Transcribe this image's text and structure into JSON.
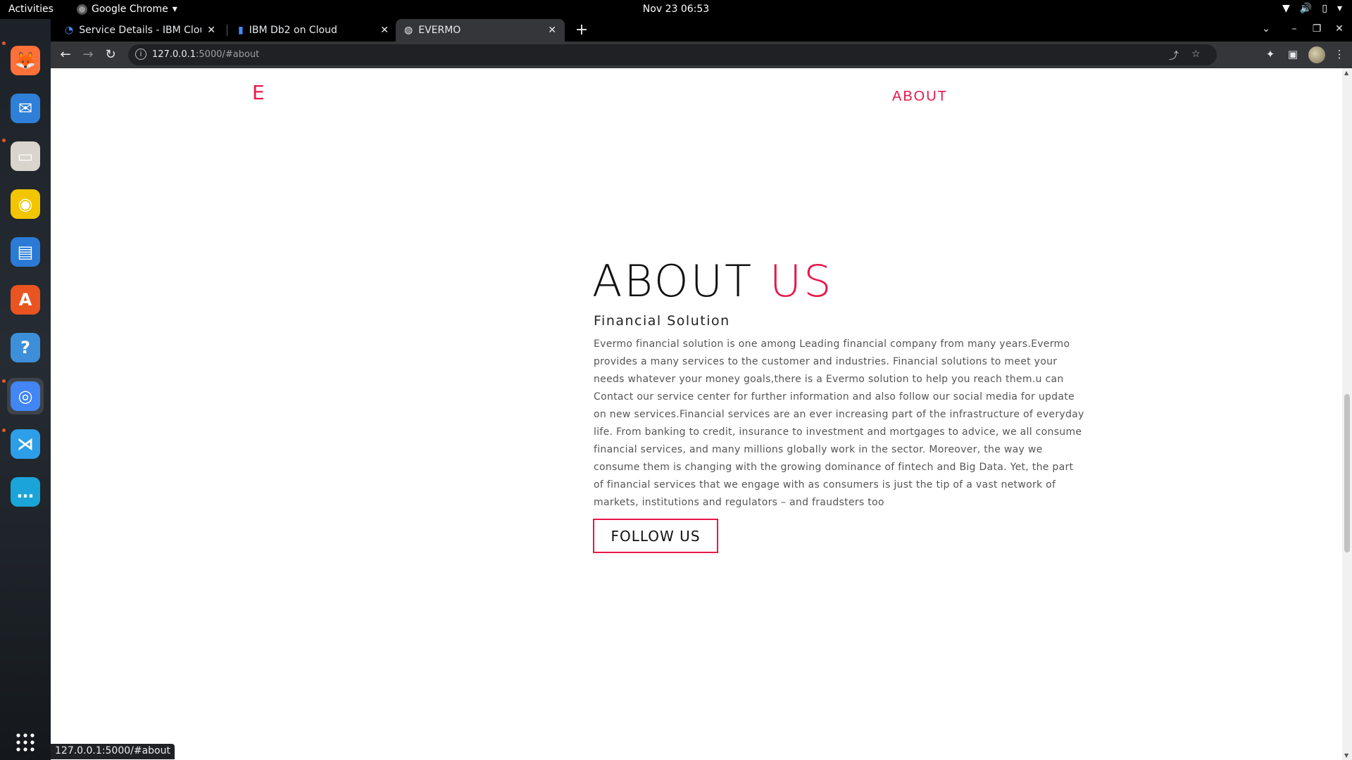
{
  "topbar": {
    "activities": "Activities",
    "app_name": "Google Chrome",
    "clock": "Nov 23  06:53"
  },
  "dock": {
    "items": [
      {
        "name": "firefox-icon",
        "glyph": "🦊",
        "color": "#ff7139"
      },
      {
        "name": "thunderbird-icon",
        "glyph": "✉",
        "color": "#2f7fd8"
      },
      {
        "name": "files-icon",
        "glyph": "▭",
        "color": "#d9d4cc"
      },
      {
        "name": "rhythmbox-icon",
        "glyph": "◉",
        "color": "#f2c500"
      },
      {
        "name": "writer-icon",
        "glyph": "▤",
        "color": "#2a7ad6"
      },
      {
        "name": "software-icon",
        "glyph": "A",
        "color": "#e95420"
      },
      {
        "name": "help-icon",
        "glyph": "?",
        "color": "#3d8fd9"
      },
      {
        "name": "chrome-icon",
        "glyph": "◎",
        "color": "#4285f4"
      },
      {
        "name": "vscode-icon",
        "glyph": "⋊",
        "color": "#2d9ee8"
      },
      {
        "name": "chat-icon",
        "glyph": "…",
        "color": "#1aa4d8"
      }
    ],
    "apps_grid": "⋮⋮⋮"
  },
  "tabs": [
    {
      "title": "Service Details - IBM Cloud",
      "icon": "ibm-cloud-icon"
    },
    {
      "title": "IBM Db2 on Cloud",
      "icon": "db2-icon"
    },
    {
      "title": "EVERMO",
      "icon": "globe-icon"
    }
  ],
  "address": {
    "host": "127.0.0.1",
    "rest": ":5000/#about"
  },
  "page": {
    "logo": "E",
    "nav_about": "ABOUT",
    "title_main": "ABOUT",
    "title_accent": "US",
    "subtitle": "Financial Solution",
    "body": "Evermo financial solution is one among Leading financial company from many years.Evermo provides a many services to the customer and industries. Financial solutions to meet your needs whatever your money goals,there is a Evermo solution to help you reach them.u can Contact our service center for further information and also follow our social media for update on new services.Financial services are an ever increasing part of the infrastructure of everyday life. From banking to credit, insurance to investment and mortgages to advice, we all consume financial services, and many millions globally work in the sector. Moreover, the way we consume them is changing with the growing dominance of fintech and Big Data. Yet, the part of financial services that we engage with as consumers is just the tip of a vast network of markets, institutions and regulators – and fraudsters too",
    "follow_button": "FOLLOW US"
  },
  "status_url": "127.0.0.1:5000/#about",
  "colors": {
    "accent": "#e8174a",
    "tab_active": "#35363a",
    "toolbar": "#35363a"
  }
}
